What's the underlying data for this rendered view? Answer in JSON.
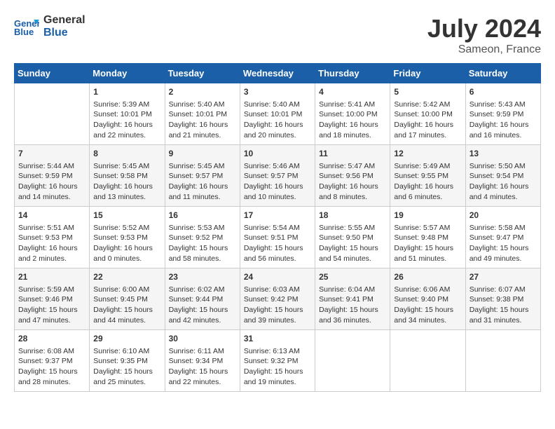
{
  "logo": {
    "line1": "General",
    "line2": "Blue"
  },
  "title": {
    "month_year": "July 2024",
    "location": "Sameon, France"
  },
  "headers": [
    "Sunday",
    "Monday",
    "Tuesday",
    "Wednesday",
    "Thursday",
    "Friday",
    "Saturday"
  ],
  "weeks": [
    [
      {
        "day": "",
        "content": ""
      },
      {
        "day": "1",
        "content": "Sunrise: 5:39 AM\nSunset: 10:01 PM\nDaylight: 16 hours\nand 22 minutes."
      },
      {
        "day": "2",
        "content": "Sunrise: 5:40 AM\nSunset: 10:01 PM\nDaylight: 16 hours\nand 21 minutes."
      },
      {
        "day": "3",
        "content": "Sunrise: 5:40 AM\nSunset: 10:01 PM\nDaylight: 16 hours\nand 20 minutes."
      },
      {
        "day": "4",
        "content": "Sunrise: 5:41 AM\nSunset: 10:00 PM\nDaylight: 16 hours\nand 18 minutes."
      },
      {
        "day": "5",
        "content": "Sunrise: 5:42 AM\nSunset: 10:00 PM\nDaylight: 16 hours\nand 17 minutes."
      },
      {
        "day": "6",
        "content": "Sunrise: 5:43 AM\nSunset: 9:59 PM\nDaylight: 16 hours\nand 16 minutes."
      }
    ],
    [
      {
        "day": "7",
        "content": "Sunrise: 5:44 AM\nSunset: 9:59 PM\nDaylight: 16 hours\nand 14 minutes."
      },
      {
        "day": "8",
        "content": "Sunrise: 5:45 AM\nSunset: 9:58 PM\nDaylight: 16 hours\nand 13 minutes."
      },
      {
        "day": "9",
        "content": "Sunrise: 5:45 AM\nSunset: 9:57 PM\nDaylight: 16 hours\nand 11 minutes."
      },
      {
        "day": "10",
        "content": "Sunrise: 5:46 AM\nSunset: 9:57 PM\nDaylight: 16 hours\nand 10 minutes."
      },
      {
        "day": "11",
        "content": "Sunrise: 5:47 AM\nSunset: 9:56 PM\nDaylight: 16 hours\nand 8 minutes."
      },
      {
        "day": "12",
        "content": "Sunrise: 5:49 AM\nSunset: 9:55 PM\nDaylight: 16 hours\nand 6 minutes."
      },
      {
        "day": "13",
        "content": "Sunrise: 5:50 AM\nSunset: 9:54 PM\nDaylight: 16 hours\nand 4 minutes."
      }
    ],
    [
      {
        "day": "14",
        "content": "Sunrise: 5:51 AM\nSunset: 9:53 PM\nDaylight: 16 hours\nand 2 minutes."
      },
      {
        "day": "15",
        "content": "Sunrise: 5:52 AM\nSunset: 9:53 PM\nDaylight: 16 hours\nand 0 minutes."
      },
      {
        "day": "16",
        "content": "Sunrise: 5:53 AM\nSunset: 9:52 PM\nDaylight: 15 hours\nand 58 minutes."
      },
      {
        "day": "17",
        "content": "Sunrise: 5:54 AM\nSunset: 9:51 PM\nDaylight: 15 hours\nand 56 minutes."
      },
      {
        "day": "18",
        "content": "Sunrise: 5:55 AM\nSunset: 9:50 PM\nDaylight: 15 hours\nand 54 minutes."
      },
      {
        "day": "19",
        "content": "Sunrise: 5:57 AM\nSunset: 9:48 PM\nDaylight: 15 hours\nand 51 minutes."
      },
      {
        "day": "20",
        "content": "Sunrise: 5:58 AM\nSunset: 9:47 PM\nDaylight: 15 hours\nand 49 minutes."
      }
    ],
    [
      {
        "day": "21",
        "content": "Sunrise: 5:59 AM\nSunset: 9:46 PM\nDaylight: 15 hours\nand 47 minutes."
      },
      {
        "day": "22",
        "content": "Sunrise: 6:00 AM\nSunset: 9:45 PM\nDaylight: 15 hours\nand 44 minutes."
      },
      {
        "day": "23",
        "content": "Sunrise: 6:02 AM\nSunset: 9:44 PM\nDaylight: 15 hours\nand 42 minutes."
      },
      {
        "day": "24",
        "content": "Sunrise: 6:03 AM\nSunset: 9:42 PM\nDaylight: 15 hours\nand 39 minutes."
      },
      {
        "day": "25",
        "content": "Sunrise: 6:04 AM\nSunset: 9:41 PM\nDaylight: 15 hours\nand 36 minutes."
      },
      {
        "day": "26",
        "content": "Sunrise: 6:06 AM\nSunset: 9:40 PM\nDaylight: 15 hours\nand 34 minutes."
      },
      {
        "day": "27",
        "content": "Sunrise: 6:07 AM\nSunset: 9:38 PM\nDaylight: 15 hours\nand 31 minutes."
      }
    ],
    [
      {
        "day": "28",
        "content": "Sunrise: 6:08 AM\nSunset: 9:37 PM\nDaylight: 15 hours\nand 28 minutes."
      },
      {
        "day": "29",
        "content": "Sunrise: 6:10 AM\nSunset: 9:35 PM\nDaylight: 15 hours\nand 25 minutes."
      },
      {
        "day": "30",
        "content": "Sunrise: 6:11 AM\nSunset: 9:34 PM\nDaylight: 15 hours\nand 22 minutes."
      },
      {
        "day": "31",
        "content": "Sunrise: 6:13 AM\nSunset: 9:32 PM\nDaylight: 15 hours\nand 19 minutes."
      },
      {
        "day": "",
        "content": ""
      },
      {
        "day": "",
        "content": ""
      },
      {
        "day": "",
        "content": ""
      }
    ]
  ]
}
